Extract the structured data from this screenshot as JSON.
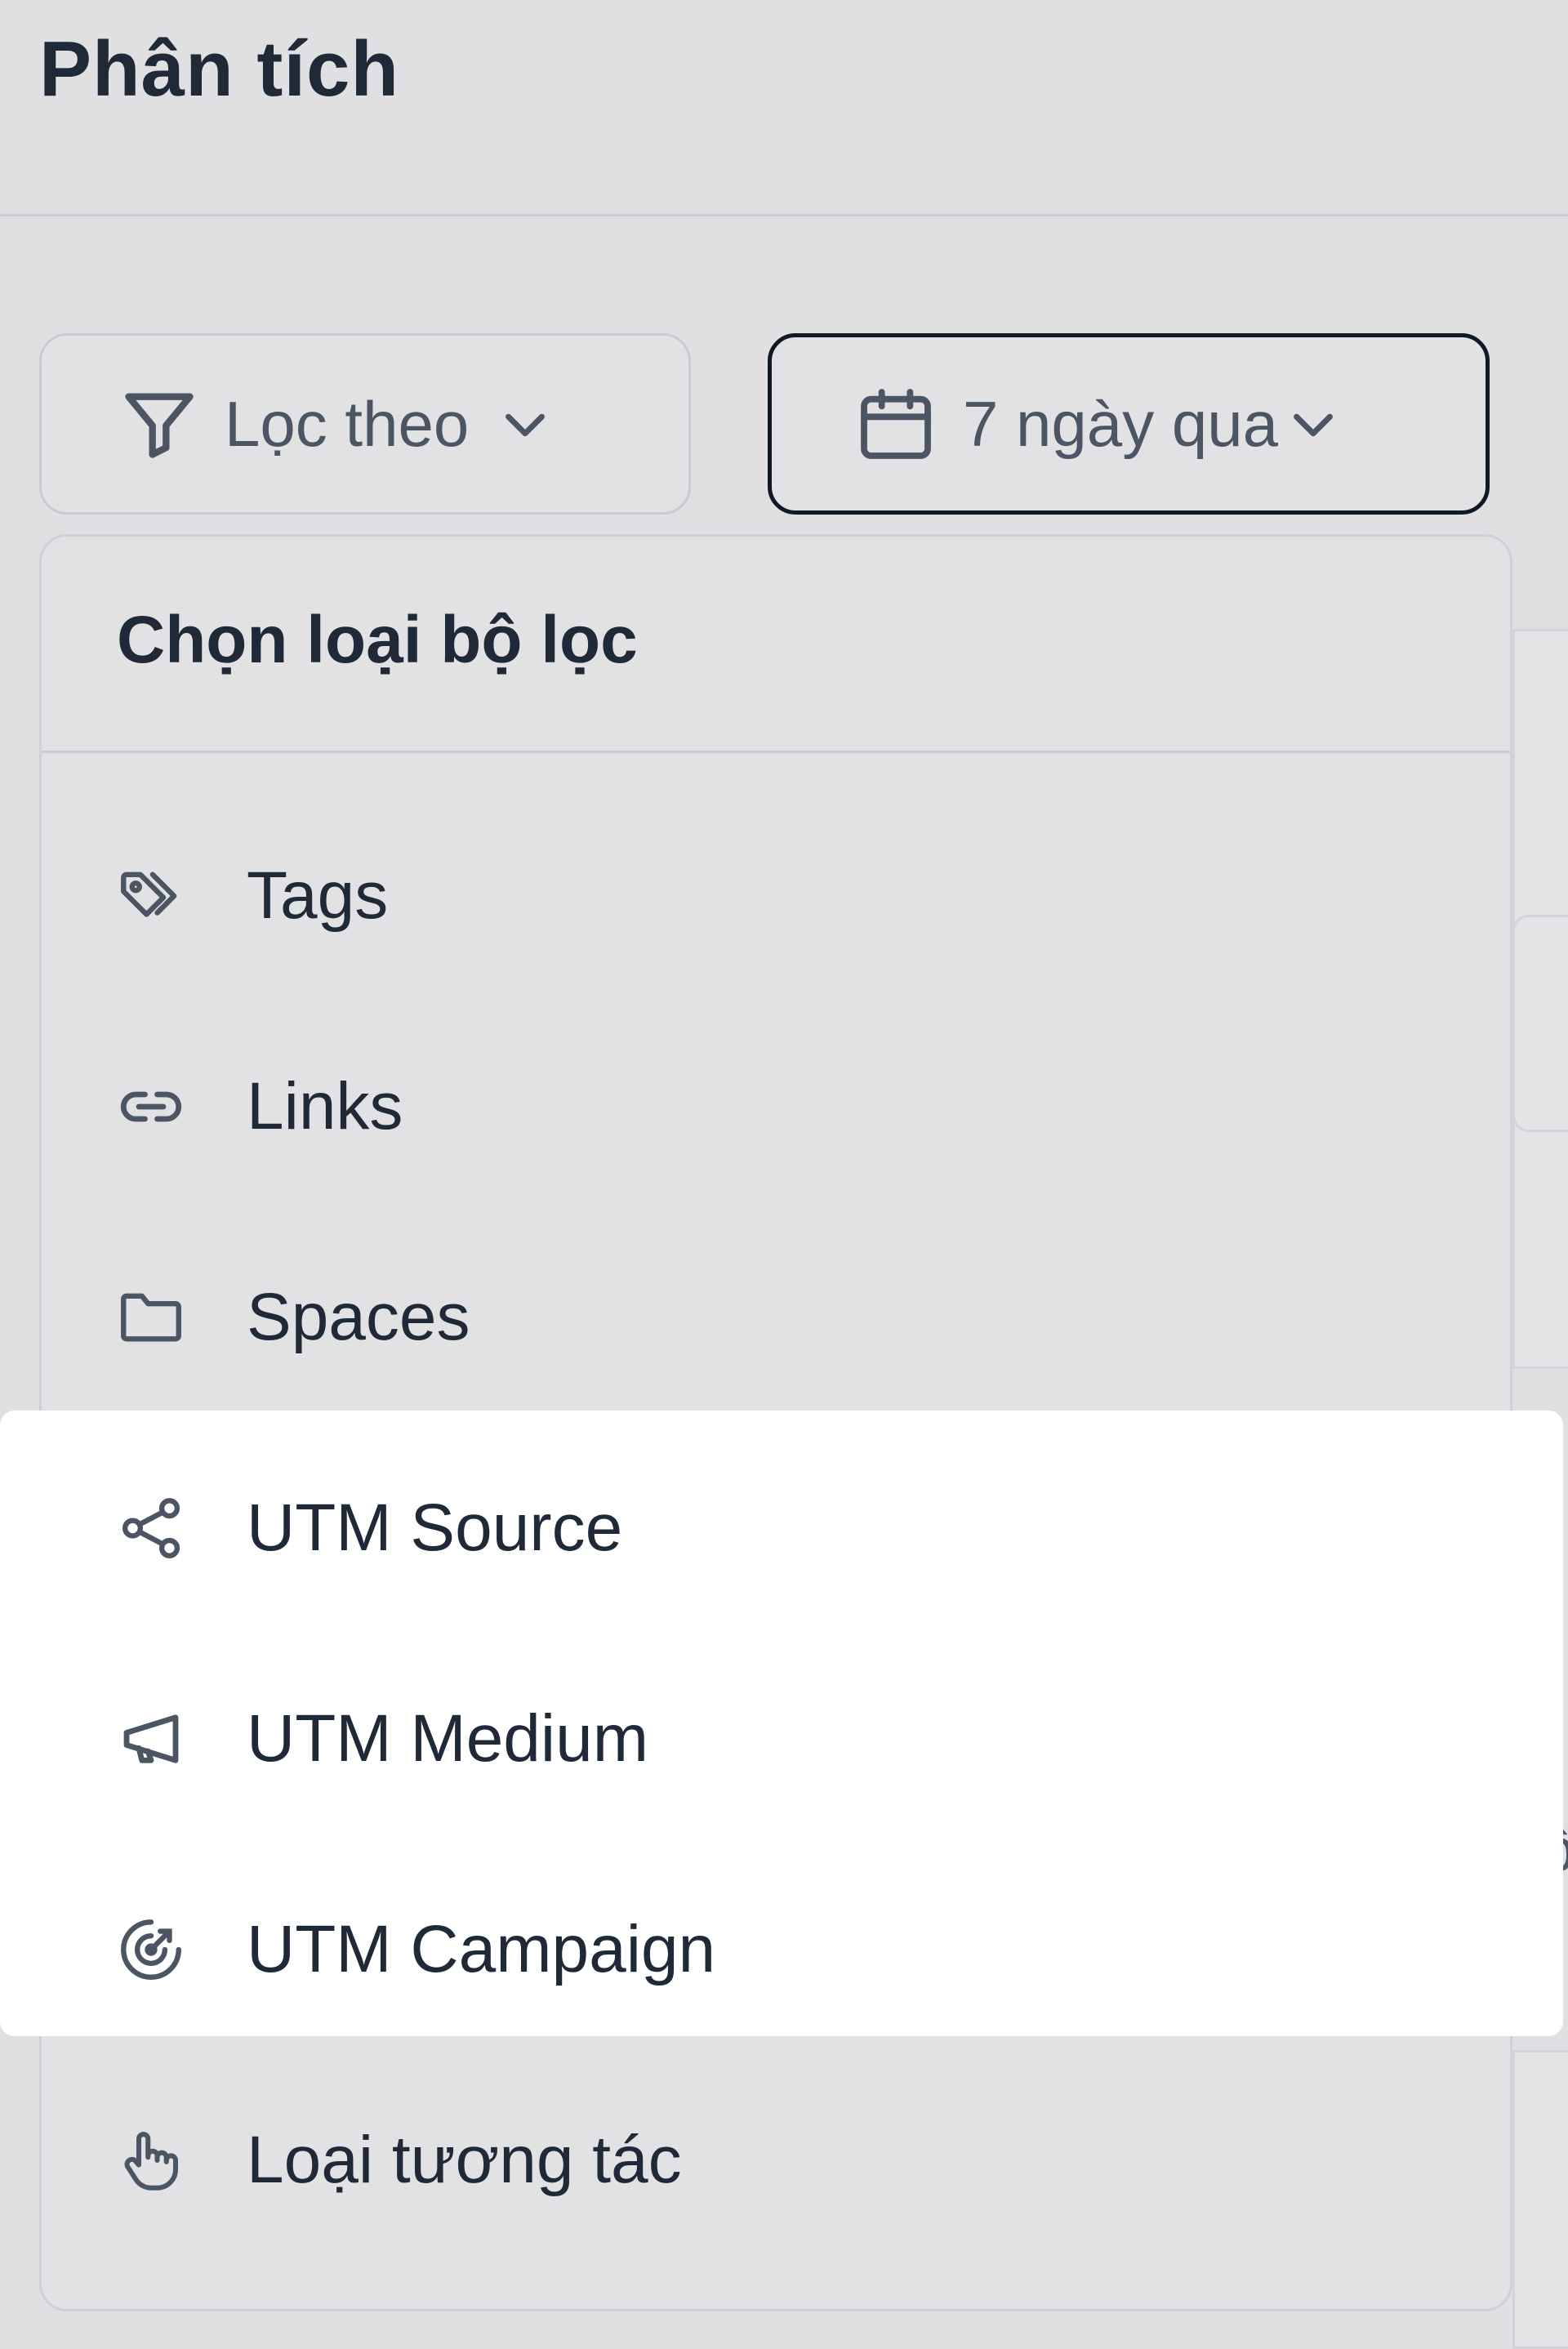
{
  "page": {
    "title": "Phân tích"
  },
  "toolbar": {
    "filter_label": "Lọc theo",
    "date_label": "7 ngày qua"
  },
  "menu": {
    "title": "Chọn loại bộ lọc",
    "items": [
      {
        "label": "Tags",
        "icon": "tag-icon"
      },
      {
        "label": "Links",
        "icon": "link-icon"
      },
      {
        "label": "Spaces",
        "icon": "folder-icon"
      },
      {
        "label": "UTM Source",
        "icon": "share-icon"
      },
      {
        "label": "UTM Medium",
        "icon": "megaphone-icon"
      },
      {
        "label": "UTM Campaign",
        "icon": "target-icon"
      },
      {
        "label": "Loại tương tác",
        "icon": "pointer-hand-icon"
      }
    ]
  },
  "background": {
    "partial_text": "cộ"
  }
}
